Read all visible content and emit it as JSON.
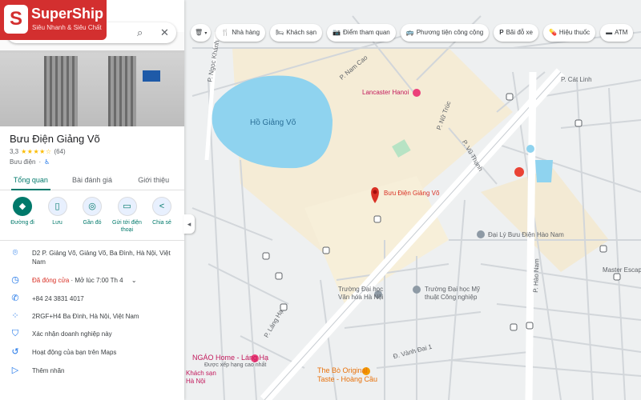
{
  "brand": {
    "name": "SuperShip",
    "tagline": "Siêu Nhanh & Siêu Chất",
    "logo_letter": "S"
  },
  "search": {
    "icons": [
      "search-icon",
      "close-icon"
    ]
  },
  "place": {
    "title": "Bưu Điện Giảng Võ",
    "rating": "3,3",
    "stars": "★★★★☆",
    "review_count": "(64)",
    "category": "Bưu điện",
    "accessibility_icon": "♿"
  },
  "tabs": [
    {
      "label": "Tổng quan",
      "active": true
    },
    {
      "label": "Bài đánh giá",
      "active": false
    },
    {
      "label": "Giới thiệu",
      "active": false
    }
  ],
  "actions": [
    {
      "label": "Đường đi",
      "icon": "◆"
    },
    {
      "label": "Lưu",
      "icon": "▯"
    },
    {
      "label": "Gần đó",
      "icon": "◎"
    },
    {
      "label": "Gửi tới điện thoại",
      "icon": "▭"
    },
    {
      "label": "Chia sẻ",
      "icon": "<"
    }
  ],
  "info": {
    "address": "D2 P. Giảng Võ, Giảng Võ, Ba Đình, Hà Nội, Việt Nam",
    "hours_status": "Đã đóng cửa",
    "hours_next": " · Mở lúc 7:00 Th 4",
    "phone": "+84 24 3831 4017",
    "plus_code": "2RGF+H4 Ba Đình, Hà Nội, Việt Nam",
    "verify": "Xác nhận doanh nghiệp này",
    "activity": "Hoạt động của bạn trên Maps",
    "add_label": "Thêm nhãn"
  },
  "chips": [
    {
      "label": "Nhà hàng",
      "icon": "🍴"
    },
    {
      "label": "Khách sạn",
      "icon": "🛏"
    },
    {
      "label": "Điểm tham quan",
      "icon": "📷"
    },
    {
      "label": "Phương tiện công cộng",
      "icon": "🚌"
    },
    {
      "label": "Bãi đỗ xe",
      "icon": "P"
    },
    {
      "label": "Hiệu thuốc",
      "icon": "💊"
    },
    {
      "label": "ATM",
      "icon": "▬"
    }
  ],
  "map_labels": {
    "lake": "Hồ Giảng Võ",
    "marker": "Bưu Điện Giảng Võ",
    "lancaster": "Lancaster Hanoi",
    "agency": "Đại Lý Bưu Điện Hào Nam",
    "university_culture": "Trường Đại học Văn hóa Hà Nội",
    "university_arts": "Trường Đại học Mỹ thuật Công nghiệp",
    "master": "Master Escap",
    "ngao": "NGÁO Home - Láng Hạ",
    "ngao_sub": "Được xếp hạng cao nhất",
    "hotel": "Khách sạn",
    "hotel_sub": "Hà Nội",
    "the_bo": "The Bò Original",
    "the_bo_sub": "Taste - Hoàng Cầu",
    "street_ngockhanh": "P. Ngọc Khánh",
    "street_namcao": "P. Nam Cao",
    "street_nutruc": "P. Nữ Trúc",
    "street_vuthanh": "P. Vũ Thạnh",
    "street_hangcho": "P. Hào Nam",
    "street_catlinh": "P. Cát Linh",
    "street_langha": "P. Láng Hạ",
    "street_vanhdai": "Đ. Vành Đai 1"
  }
}
